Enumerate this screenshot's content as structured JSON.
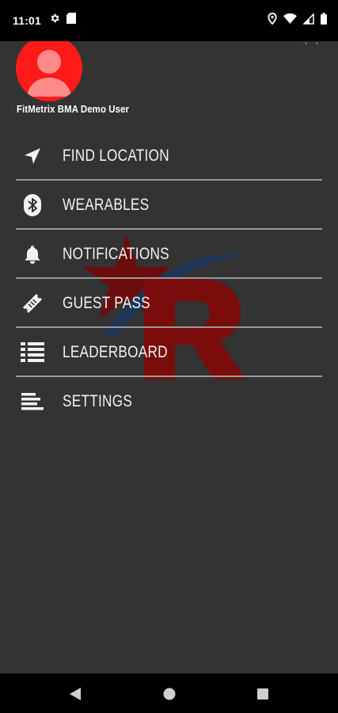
{
  "status_bar": {
    "time": "11:01",
    "left_icons": [
      "gear-icon",
      "sim-card-icon"
    ],
    "right_icons": [
      "location-pin-icon",
      "wifi-icon",
      "cell-signal-icon",
      "battery-icon"
    ]
  },
  "profile": {
    "name": "FitMetrix BMA Demo User",
    "avatar_color": "#ff1a1a"
  },
  "menu": {
    "items": [
      {
        "label": "FIND LOCATION",
        "icon": "navigation-arrow-icon"
      },
      {
        "label": "WEARABLES",
        "icon": "bluetooth-icon"
      },
      {
        "label": "NOTIFICATIONS",
        "icon": "bell-icon"
      },
      {
        "label": "GUEST PASS",
        "icon": "ticket-icon"
      },
      {
        "label": "LEADERBOARD",
        "icon": "ranked-list-icon"
      },
      {
        "label": "SETTINGS",
        "icon": "settings-lines-icon"
      }
    ]
  },
  "nav_bar": {
    "buttons": [
      "back-icon",
      "home-icon",
      "recents-icon"
    ]
  },
  "colors": {
    "drawer_background": "#333333",
    "divider": "#9a9a9a",
    "text": "#f2f2f2",
    "system_bars": "#000000"
  }
}
